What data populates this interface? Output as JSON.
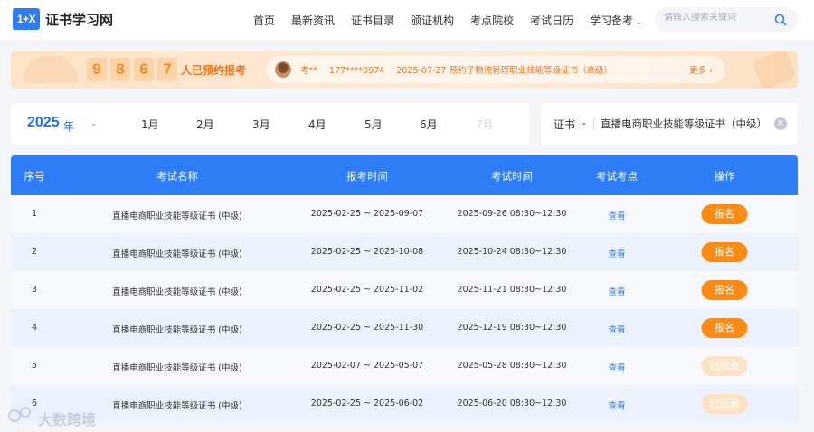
{
  "header": {
    "logo_mark": "1+X",
    "logo_text": "证书学习网",
    "nav": [
      "首页",
      "最新资讯",
      "证书目录",
      "颁证机构",
      "考点院校",
      "考试日历",
      "学习备考"
    ],
    "search_placeholder": "请输入搜索关键词"
  },
  "banner": {
    "digits": [
      "9",
      "8",
      "6",
      "7"
    ],
    "label": "人已预约报考",
    "ticker": {
      "name": "考**",
      "phone": "177****0974",
      "message": "2025-07-27 预约了物流管理职业技能等级证书（高级）"
    },
    "more": "更多 ›"
  },
  "filter": {
    "year": "2025",
    "year_unit": "年",
    "months": [
      "1月",
      "2月",
      "3月",
      "4月",
      "5月",
      "6月",
      "7月"
    ],
    "cert_type": "证书",
    "cert_name": "直播电商职业技能等级证书（中级）"
  },
  "table": {
    "headers": [
      "序号",
      "考试名称",
      "报考时间",
      "考试时间",
      "考试考点",
      "操作"
    ],
    "rows": [
      {
        "no": "1",
        "name": "直播电商职业技能等级证书 (中级)",
        "reg": "2025-02-25 ~ 2025-09-07",
        "exam": "2025-09-26 08:30~12:30",
        "site": "查看",
        "action": "报名"
      },
      {
        "no": "2",
        "name": "直播电商职业技能等级证书 (中级)",
        "reg": "2025-02-25 ~ 2025-10-08",
        "exam": "2025-10-24 08:30~12:30",
        "site": "查看",
        "action": "报名"
      },
      {
        "no": "3",
        "name": "直播电商职业技能等级证书 (中级)",
        "reg": "2025-02-25 ~ 2025-11-02",
        "exam": "2025-11-21 08:30~12:30",
        "site": "查看",
        "action": "报名"
      },
      {
        "no": "4",
        "name": "直播电商职业技能等级证书 (中级)",
        "reg": "2025-02-25 ~ 2025-11-30",
        "exam": "2025-12-19 08:30~12:30",
        "site": "查看",
        "action": "报名"
      },
      {
        "no": "5",
        "name": "直播电商职业技能等级证书 (中级)",
        "reg": "2025-02-07 ~ 2025-05-07",
        "exam": "2025-05-28 08:30~12:30",
        "site": "查看",
        "action": "已结束"
      },
      {
        "no": "6",
        "name": "直播电商职业技能等级证书 (中级)",
        "reg": "2025-02-25 ~ 2025-06-02",
        "exam": "2025-06-20 08:30~12:30",
        "site": "查看",
        "action": "已结束"
      }
    ]
  },
  "watermark": "大数跨境",
  "colors": {
    "primary": "#2e7cf6",
    "accent": "#fa8c16",
    "closed": "#fde3c5"
  }
}
